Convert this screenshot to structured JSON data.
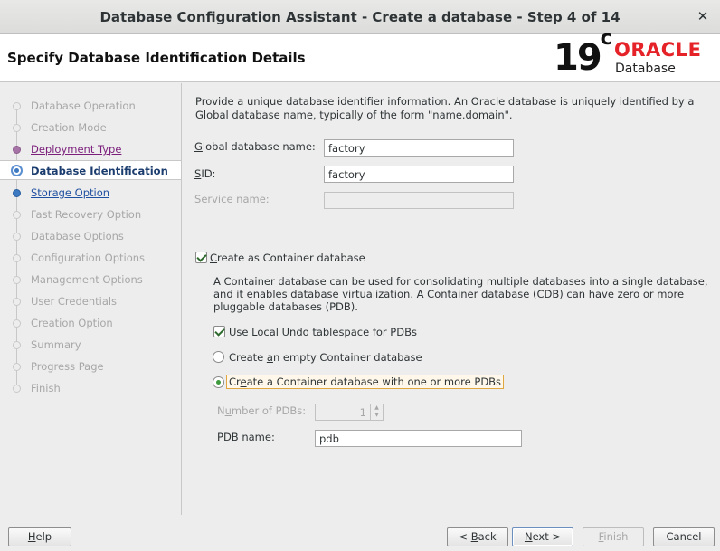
{
  "window": {
    "title": "Database Configuration Assistant - Create a database - Step 4 of 14",
    "close_glyph": "✕"
  },
  "header": {
    "heading": "Specify Database Identification Details",
    "logo": {
      "version": "19",
      "version_suffix": "c",
      "brand": "ORACLE",
      "product": "Database",
      "brand_color": "#e52228"
    }
  },
  "steps": [
    {
      "label": "Database Operation",
      "state": "completed"
    },
    {
      "label": "Creation Mode",
      "state": "completed"
    },
    {
      "label": "Deployment Type",
      "state": "visited"
    },
    {
      "label": "Database Identification",
      "state": "current"
    },
    {
      "label": "Storage Option",
      "state": "next"
    },
    {
      "label": "Fast Recovery Option",
      "state": "pending"
    },
    {
      "label": "Database Options",
      "state": "pending"
    },
    {
      "label": "Configuration Options",
      "state": "pending"
    },
    {
      "label": "Management Options",
      "state": "pending"
    },
    {
      "label": "User Credentials",
      "state": "pending"
    },
    {
      "label": "Creation Option",
      "state": "pending"
    },
    {
      "label": "Summary",
      "state": "pending"
    },
    {
      "label": "Progress Page",
      "state": "pending"
    },
    {
      "label": "Finish",
      "state": "pending"
    }
  ],
  "form": {
    "intro": "Provide a unique database identifier information. An Oracle database is uniquely identified by a Global database name, typically of the form \"name.domain\".",
    "global_db_name": {
      "mnemonic": "G",
      "label_rest": "lobal database name:",
      "value": "factory"
    },
    "sid": {
      "mnemonic": "S",
      "label_rest": "ID:",
      "value": "factory"
    },
    "service_name": {
      "mnemonic": "S",
      "label_rest": "ervice name:",
      "value": ""
    },
    "container": {
      "checkbox": {
        "mnemonic": "C",
        "label_rest": "reate as Container database",
        "checked": true
      },
      "description": "A Container database can be used for consolidating multiple databases into a single database, and it enables database virtualization. A Container database (CDB) can have zero or more pluggable databases (PDB).",
      "local_undo": {
        "before": "Use ",
        "mnemonic": "L",
        "after": "ocal Undo tablespace for PDBs",
        "checked": true
      },
      "empty_option": {
        "before": "Create ",
        "mnemonic": "a",
        "after": "n empty Container database",
        "selected": false
      },
      "pdb_option": {
        "before": "Cr",
        "mnemonic": "e",
        "after": "ate a Container database with one or more PDBs",
        "selected": true
      },
      "num_pdbs": {
        "before": "N",
        "mnemonic": "u",
        "after": "mber of PDBs:",
        "value": "1"
      },
      "pdb_name": {
        "mnemonic": "P",
        "label_rest": "DB name:",
        "value": "pdb"
      }
    }
  },
  "buttons": {
    "help": {
      "mnemonic": "H",
      "rest": "elp"
    },
    "back": {
      "prefix": "< ",
      "mnemonic": "B",
      "rest": "ack"
    },
    "next": {
      "mnemonic": "N",
      "rest": "ext >"
    },
    "finish": {
      "mnemonic": "F",
      "rest": "inish"
    },
    "cancel": {
      "label": "Cancel"
    }
  }
}
